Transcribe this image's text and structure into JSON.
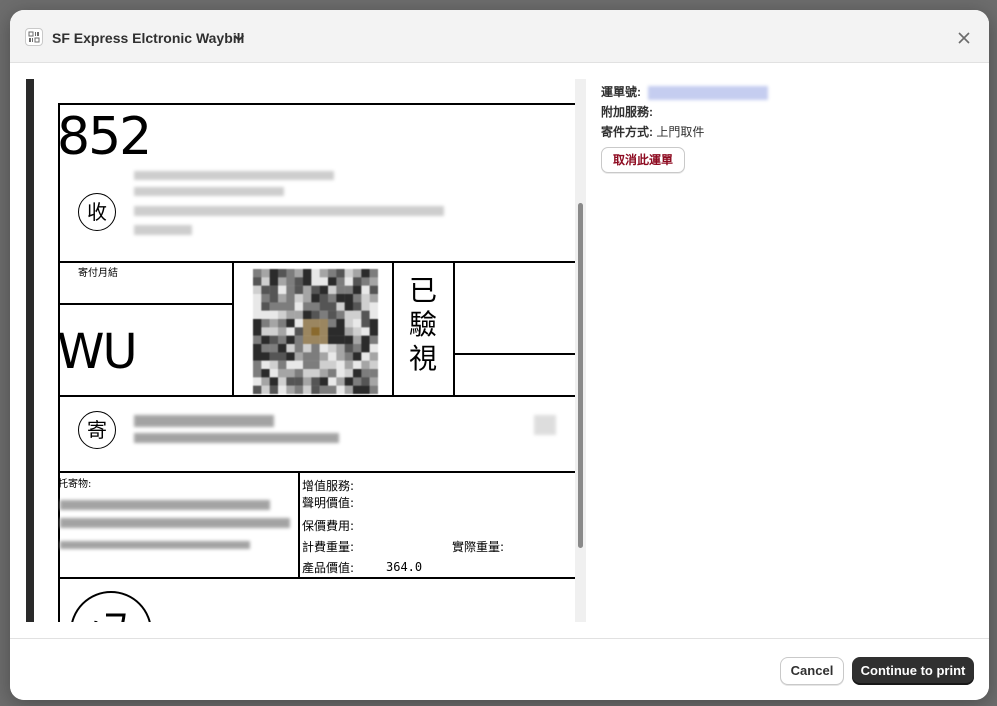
{
  "modal": {
    "title": "SF Express Elctronic Waybill",
    "icon": "barcode-icon",
    "close_icon": "close-icon"
  },
  "waybill": {
    "route_code_top": "852",
    "recipient_mark": "收",
    "payment_label": "寄付月結",
    "route_code_bottom": "WU",
    "verified_text": "已驗視",
    "sender_mark": "寄",
    "contents_label": "托寄物:",
    "value_added_services_label": "增值服務:",
    "declared_value_label": "聲明價值:",
    "insurance_fee_label": "保價費用:",
    "billable_weight_label": "計費重量:",
    "actual_weight_label": "實際重量:",
    "product_value_label": "產品價值:",
    "product_value": "364.0"
  },
  "shipment_info": {
    "tracking_label": "運單號:",
    "additional_services_label": "附加服務:",
    "pickup_method_label": "寄件方式:",
    "pickup_method_value": "上門取件",
    "cancel_waybill_label": "取消此運單"
  },
  "footer": {
    "cancel_label": "Cancel",
    "continue_label": "Continue to print"
  },
  "colors": {
    "primary_button": "#303030",
    "destructive_text": "#8e0b21"
  }
}
